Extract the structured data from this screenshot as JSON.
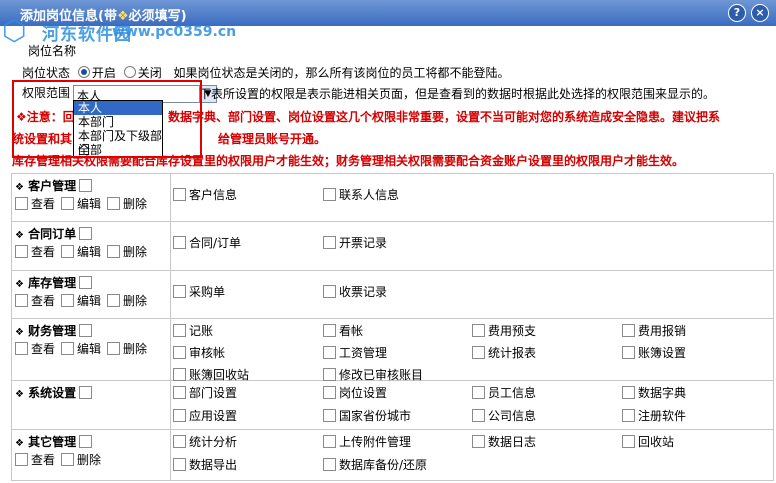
{
  "window": {
    "title_main": "添加岗位信息(带",
    "title_star": "❖",
    "title_rest": "必须填写)",
    "help_label": "?",
    "close_label": "×"
  },
  "watermark": {
    "logo": "⬡",
    "text": "河东软件园",
    "url": "www.pc0359.cn"
  },
  "form": {
    "position_name_label": "岗位名称",
    "status_label": "岗位状态",
    "status_on": "开启",
    "status_off": "关闭",
    "status_note": "如果岗位状态是关闭的，那么所有该岗位的员工将都不能登陆。",
    "scope_label": "权限范围",
    "scope_value": "本人",
    "scope_options": [
      "本人",
      "本部门",
      "本部门及下级部门",
      "全部"
    ],
    "scope_desc": "下表所设置的权限是表示能进相关页面，但是查看到的数据时根据此处选择的权限范围来显示的。"
  },
  "warnings": {
    "w1a": "❖注意：回",
    "w1b": "数据字典、部门设置、岗位设置这几个权限非常重要，设置不当可能对您的系统造成安全隐患。建议把系",
    "w2": "统设置和其",
    "w2b": "给管理员账号开通。",
    "w3": "库存管理相关权限需要配合库存设置里的权限用户才能生效；财务管理相关权限需要配合资金账户设置里的权限用户才能生效。"
  },
  "modules": [
    {
      "name": "客户管理",
      "opts": [
        "查看",
        "编辑",
        "删除"
      ],
      "perms": [
        "客户信息",
        "联系人信息"
      ]
    },
    {
      "name": "合同订单",
      "opts": [
        "查看",
        "编辑",
        "删除"
      ],
      "perms": [
        "合同/订单",
        "开票记录"
      ]
    },
    {
      "name": "库存管理",
      "opts": [
        "查看",
        "编辑",
        "删除"
      ],
      "perms": [
        "采购单",
        "收票记录"
      ]
    },
    {
      "name": "财务管理",
      "opts": [
        "查看",
        "编辑",
        "删除"
      ],
      "perms": [
        "记账",
        "看帐",
        "费用预支",
        "费用报销",
        "审核帐",
        "工资管理",
        "统计报表",
        "账簿设置",
        "账簿回收站",
        "修改已审核账目"
      ]
    },
    {
      "name": "系统设置",
      "opts": [],
      "perms": [
        "部门设置",
        "岗位设置",
        "员工信息",
        "数据字典",
        "应用设置",
        "国家省份城市",
        "公司信息",
        "注册软件"
      ]
    },
    {
      "name": "其它管理",
      "opts": [
        "查看",
        "删除"
      ],
      "perms": [
        "统计分析",
        "上传附件管理",
        "数据日志",
        "回收站",
        "数据导出",
        "数据库备份/还原"
      ]
    }
  ]
}
